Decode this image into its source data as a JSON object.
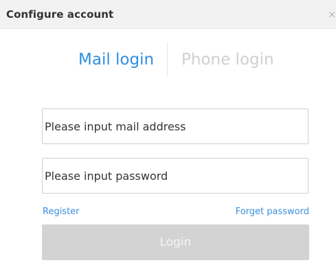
{
  "window": {
    "title": "Configure account",
    "close_glyph": "×"
  },
  "tabs": {
    "mail": "Mail login",
    "phone": "Phone login",
    "active": "mail"
  },
  "form": {
    "mail_placeholder": "Please input mail address",
    "mail_value": "",
    "password_placeholder": "Please input password",
    "password_value": ""
  },
  "links": {
    "register": "Register",
    "forget": "Forget password"
  },
  "actions": {
    "login": "Login"
  },
  "colors": {
    "accent": "#2f8fe0",
    "link": "#3b8fdc",
    "inactive_tab": "#cfcfcf",
    "button_disabled": "#d3d3d3"
  },
  "icons": {
    "close": "close-icon"
  }
}
